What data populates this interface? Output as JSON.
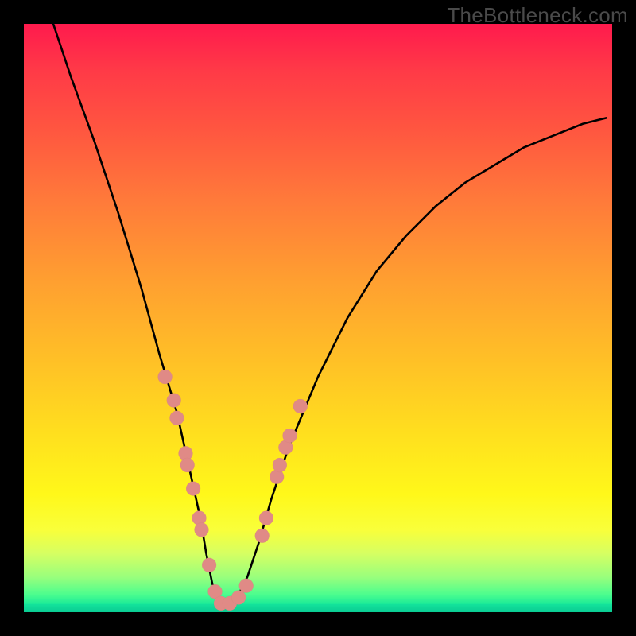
{
  "watermark": "TheBottleneck.com",
  "colors": {
    "frame": "#000000",
    "curve": "#000000",
    "dot": "#e08a86",
    "gradient_top": "#ff1a4d",
    "gradient_bottom": "#0bd298"
  },
  "chart_data": {
    "type": "line",
    "title": "",
    "xlabel": "",
    "ylabel": "",
    "xlim": [
      0,
      100
    ],
    "ylim": [
      0,
      100
    ],
    "note": "Axes are unlabeled in the source image; values are relative percentages of plot width/height estimated from pixel positions.",
    "series": [
      {
        "name": "bottleneck-curve",
        "x": [
          5,
          8,
          12,
          16,
          20,
          23,
          26,
          28,
          30,
          31,
          32,
          33,
          34,
          36,
          38,
          40,
          42,
          45,
          50,
          55,
          60,
          65,
          70,
          75,
          80,
          85,
          90,
          95,
          99
        ],
        "y": [
          100,
          91,
          80,
          68,
          55,
          44,
          34,
          25,
          16,
          10,
          5,
          2,
          1,
          2,
          6,
          12,
          19,
          28,
          40,
          50,
          58,
          64,
          69,
          73,
          76,
          79,
          81,
          83,
          84
        ]
      }
    ],
    "markers": {
      "name": "highlighted-points",
      "color": "#e08a86",
      "points": [
        {
          "x": 24.0,
          "y": 40.0
        },
        {
          "x": 25.5,
          "y": 36.0
        },
        {
          "x": 26.0,
          "y": 33.0
        },
        {
          "x": 27.5,
          "y": 27.0
        },
        {
          "x": 27.8,
          "y": 25.0
        },
        {
          "x": 28.8,
          "y": 21.0
        },
        {
          "x": 29.8,
          "y": 16.0
        },
        {
          "x": 30.2,
          "y": 14.0
        },
        {
          "x": 31.5,
          "y": 8.0
        },
        {
          "x": 32.5,
          "y": 3.5
        },
        {
          "x": 33.5,
          "y": 1.5
        },
        {
          "x": 35.0,
          "y": 1.5
        },
        {
          "x": 36.5,
          "y": 2.5
        },
        {
          "x": 37.8,
          "y": 4.5
        },
        {
          "x": 40.5,
          "y": 13.0
        },
        {
          "x": 41.2,
          "y": 16.0
        },
        {
          "x": 43.0,
          "y": 23.0
        },
        {
          "x": 43.5,
          "y": 25.0
        },
        {
          "x": 44.5,
          "y": 28.0
        },
        {
          "x": 45.2,
          "y": 30.0
        },
        {
          "x": 47.0,
          "y": 35.0
        }
      ]
    }
  }
}
